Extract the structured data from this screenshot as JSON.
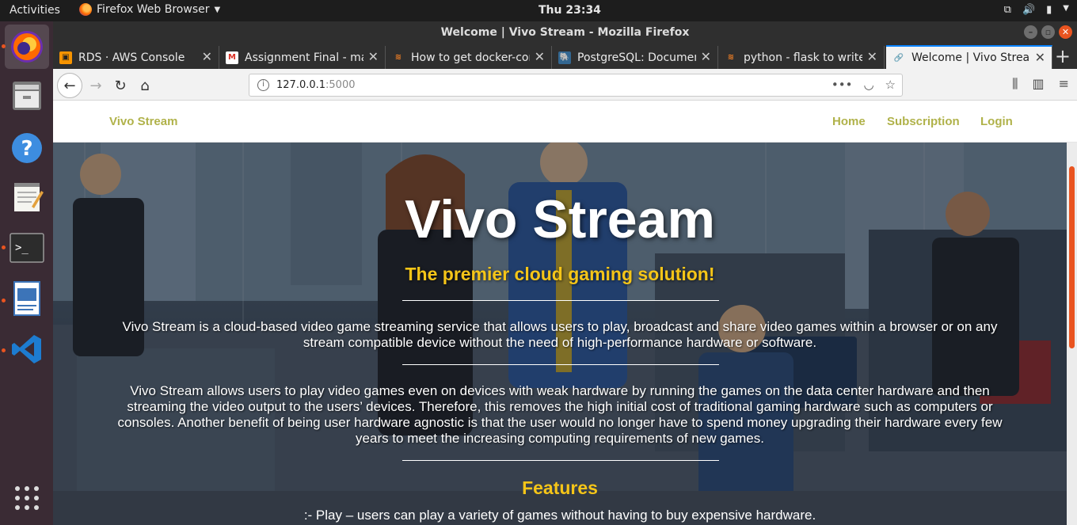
{
  "topbar": {
    "activities": "Activities",
    "app_name": "Firefox Web Browser",
    "clock": "Thu 23:34"
  },
  "window": {
    "title": "Welcome | Vivo Stream - Mozilla Firefox"
  },
  "tabs": [
    {
      "title": "RDS · AWS Console",
      "icon": "aws-icon",
      "color": "#f79400"
    },
    {
      "title": "Assignment Final - mat",
      "icon": "gmail-icon",
      "color": "#d93025"
    },
    {
      "title": "How to get docker-con",
      "icon": "stackoverflow-icon",
      "color": "#f48024"
    },
    {
      "title": "PostgreSQL: Documen",
      "icon": "postgresql-icon",
      "color": "#336791"
    },
    {
      "title": "python - flask to write",
      "icon": "stackoverflow-icon",
      "color": "#f48024"
    },
    {
      "title": "Welcome | Vivo Stream",
      "icon": "link-icon",
      "color": "#4a9a3a"
    }
  ],
  "url": {
    "host": "127.0.0.1",
    "port": ":5000"
  },
  "site": {
    "brand": "Vivo Stream",
    "nav": [
      "Home",
      "Subscription",
      "Login"
    ],
    "hero_title": "Vivo Stream",
    "tagline": "The premier cloud gaming solution!",
    "para1": "Vivo Stream is a cloud-based video game streaming service that allows users to play, broadcast and share video games within a browser or on any stream compatible device without the need of high-performance hardware or software.",
    "para2": "Vivo Stream allows users to play video games even on devices with weak hardware by running the games on the data center hardware and then streaming the video output to the users’ devices. Therefore, this removes the high initial cost of traditional gaming hardware such as computers or consoles. Another benefit of being user hardware agnostic is that the user would no longer have to spend money upgrading their hardware every few years to meet the increasing computing requirements of new games.",
    "features_heading": "Features",
    "feature1": ":- Play – users can play a variety of games without having to buy expensive hardware."
  },
  "colors": {
    "nav_link": "#b0b24a",
    "accent_yellow": "#f5c518",
    "ubuntu_orange": "#e95420",
    "dock_bg": "#3a2b34"
  },
  "dock": [
    "firefox-icon",
    "files-icon",
    "help-icon",
    "text-editor-icon",
    "terminal-icon",
    "document-viewer-icon",
    "vscode-icon",
    "app-grid-icon"
  ]
}
